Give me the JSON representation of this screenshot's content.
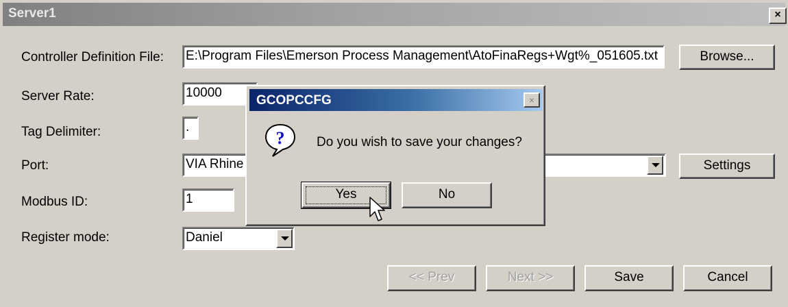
{
  "window": {
    "title": "Server1",
    "close_glyph": "×"
  },
  "form": {
    "controller_file_label": "Controller Definition File:",
    "controller_file_value": "E:\\Program Files\\Emerson Process Management\\AtoFinaRegs+Wgt%_051605.txt",
    "browse_label": "Browse...",
    "server_rate_label": "Server Rate:",
    "server_rate_value": "10000",
    "tag_delimiter_label": "Tag Delimiter:",
    "tag_delimiter_value": ".",
    "port_label": "Port:",
    "port_value": "VIA Rhine",
    "settings_label": "Settings",
    "modbus_id_label": "Modbus ID:",
    "modbus_id_value": "1",
    "register_mode_label": "Register mode:",
    "register_mode_value": "Daniel"
  },
  "footer": {
    "prev_label": "<< Prev",
    "next_label": "Next >>",
    "save_label": "Save",
    "cancel_label": "Cancel"
  },
  "dialog": {
    "title": "GCOPCCFG",
    "close_glyph": "×",
    "icon": "question-icon",
    "message": "Do you wish to save your changes?",
    "yes_label": "Yes",
    "no_label": "No"
  },
  "colors": {
    "face": "#d4d0c8",
    "dialog_title_start": "#0a246a",
    "dialog_title_end": "#a6caf0",
    "question_icon": "#1010c0"
  }
}
